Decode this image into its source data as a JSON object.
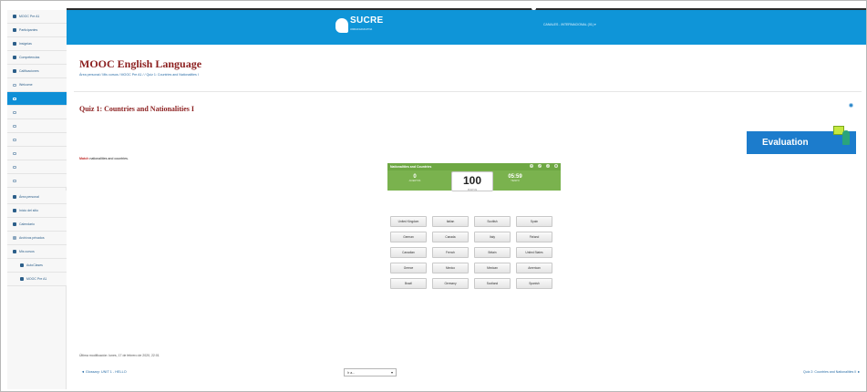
{
  "sidebar": {
    "items": [
      {
        "label": "MOOC Pre A1",
        "icon": "graduation-cap-icon"
      },
      {
        "label": "Participantes",
        "icon": "users-icon"
      },
      {
        "label": "Insignias",
        "icon": "badge-icon"
      },
      {
        "label": "Competencias",
        "icon": "check-icon"
      },
      {
        "label": "Calificaciones",
        "icon": "grid-icon"
      },
      {
        "label": "Welcome",
        "icon": "folder-icon"
      },
      {
        "label": "",
        "icon": "folder-icon"
      },
      {
        "label": "",
        "icon": "folder-icon"
      },
      {
        "label": "",
        "icon": "folder-icon"
      },
      {
        "label": "",
        "icon": "folder-icon"
      },
      {
        "label": "",
        "icon": "folder-icon"
      },
      {
        "label": "",
        "icon": "folder-icon"
      },
      {
        "label": "",
        "icon": "folder-icon"
      },
      {
        "label": "Área personal",
        "icon": "home-icon"
      },
      {
        "label": "Inicio del sitio",
        "icon": "house-icon"
      },
      {
        "label": "Calendario",
        "icon": "calendar-icon"
      },
      {
        "label": "Archivos privados",
        "icon": "file-icon"
      },
      {
        "label": "Mis cursos",
        "icon": "graduation-cap-icon"
      },
      {
        "label": "AutoClases",
        "icon": "graduation-cap-icon"
      },
      {
        "label": "MOOC Pre A1",
        "icon": "graduation-cap-icon"
      }
    ],
    "accent": "#0e8fd6"
  },
  "header": {
    "logo_text": "SUCRE",
    "logo_tagline": "UNIDAD EDUCATIVA",
    "user_menu": "CANALES - INTERNACIONAL (01) ▾",
    "bar_color": "#0f95d8"
  },
  "course": {
    "title": "MOOC English Language",
    "breadcrumb": "Área personal  /  Mis cursos  /  MOOC Pre A1  /   /  Quiz 1: Countries and Nationalities I"
  },
  "quiz": {
    "title": "Quiz 1: Countries and Nationalities I",
    "badge": "Evaluation",
    "intro_prefix": "Match",
    "intro_text": " nationalities and countries."
  },
  "game": {
    "title": "Nationalities and Countries",
    "left_value": "0",
    "left_sub": "ACIERTOS",
    "score": "100",
    "score_sub": "PUNTOS",
    "time": "05:59",
    "time_sub": "TIEMPO",
    "header_icons": [
      "help-icon",
      "fullscreen-icon",
      "sound-icon",
      "settings-icon"
    ]
  },
  "grid": {
    "cells": [
      "United Kingdom",
      "Italian",
      "Scottish",
      "Spain",
      "German",
      "Canada",
      "Italy",
      "Finland",
      "Canadian",
      "French",
      "Britain",
      "United States",
      "Greece",
      "Mexico",
      "Mexican",
      "American",
      "Brazil",
      "Germany",
      "Scotland",
      "Spanish"
    ]
  },
  "footer": {
    "modified": "Última modificación: lunes, 17 de febrero de 2020, 22:01",
    "prev_link": "◄ Glossary: UNIT 1 - HELLO",
    "jump_value": "Ir a...",
    "next_link": "Quiz 2: Countries and Nationalities II ►"
  }
}
